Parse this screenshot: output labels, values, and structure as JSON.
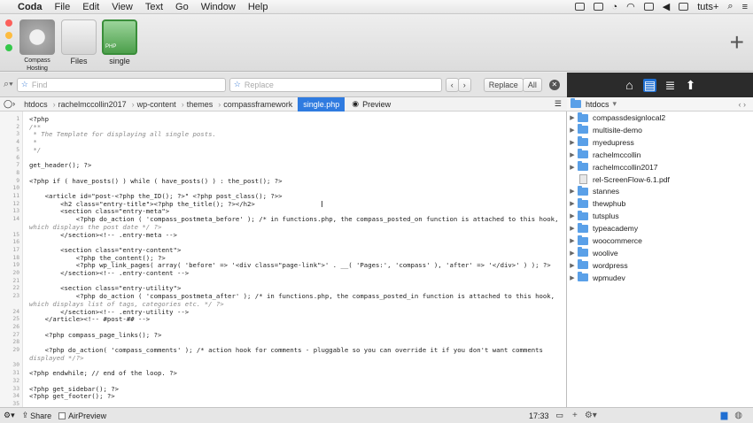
{
  "menubar": {
    "app": "Coda",
    "menus": [
      "File",
      "Edit",
      "View",
      "Text",
      "Go",
      "Window",
      "Help"
    ],
    "user": "tuts+"
  },
  "sites": [
    {
      "label": "Compass Hosting",
      "color": "#a9a9a9"
    },
    {
      "label": "Files",
      "color": "#d7d7d7"
    },
    {
      "label": "single",
      "color": "#7cc47b",
      "badge": "PHP"
    }
  ],
  "find": {
    "find_placeholder": "Find",
    "replace_placeholder": "Replace",
    "replace_btn": "Replace",
    "all_btn": "All"
  },
  "breadcrumbs": [
    "htdocs",
    "rachelmccollin2017",
    "wp-content",
    "themes",
    "compassframework",
    "single.php"
  ],
  "preview_label": "Preview",
  "rightpanel": {
    "path": "htdocs",
    "items": [
      {
        "name": "compassdesignlocal2",
        "type": "folder"
      },
      {
        "name": "multisite-demo",
        "type": "folder"
      },
      {
        "name": "myedupress",
        "type": "folder"
      },
      {
        "name": "rachelmccollin",
        "type": "folder"
      },
      {
        "name": "rachelmccollin2017",
        "type": "folder"
      },
      {
        "name": "rel-ScreenFlow-6.1.pdf",
        "type": "file"
      },
      {
        "name": "stannes",
        "type": "folder"
      },
      {
        "name": "thewphub",
        "type": "folder"
      },
      {
        "name": "tutsplus",
        "type": "folder"
      },
      {
        "name": "typeacademy",
        "type": "folder"
      },
      {
        "name": "woocommerce",
        "type": "folder"
      },
      {
        "name": "woolive",
        "type": "folder"
      },
      {
        "name": "wordpress",
        "type": "folder"
      },
      {
        "name": "wpmudev",
        "type": "folder"
      }
    ]
  },
  "code_lines": [
    "<?php",
    "/**",
    " * The Template for displaying all single posts.",
    " *",
    " */",
    "",
    "get_header(); ?>",
    "",
    "<?php if ( have_posts() ) while ( have_posts() ) : the_post(); ?>",
    "",
    "    <article id=\"post-<?php the_ID(); ?>\" <?php post_class(); ?>>",
    "        <h2 class=\"entry-title\"><?php the_title(); ?></h2>",
    "        <section class=\"entry-meta\">",
    "            <?php do_action ( 'compass_postmeta_before' ); /* in functions.php, the compass_posted_on function is attached to this hook,",
    "which displays the post date */ ?>",
    "        </section><!-- .entry-meta -->",
    "",
    "        <section class=\"entry-content\">",
    "            <?php the_content(); ?>",
    "            <?php wp_link_pages( array( 'before' => '<div class=\"page-link\">' . __( 'Pages:', 'compass' ), 'after' => '</div>' ) ); ?>",
    "        </section><!-- .entry-content -->",
    "",
    "        <section class=\"entry-utility\">",
    "            <?php do_action ( 'compass_postmeta_after' ); /* in functions.php, the compass_posted_in function is attached to this hook,",
    "which displays list of tags, categories etc. */ ?>",
    "        </section><!-- .entry-utility -->",
    "    </article><!-- #post-## -->",
    "",
    "    <?php compass_page_links(); ?>",
    "",
    "    <?php do_action( 'compass_comments' ); /* action hook for comments - pluggable so you can override it if you don't want comments",
    "displayed */?>",
    "",
    "<?php endwhile; // end of the loop. ?>",
    "",
    "<?php get_sidebar(); ?>",
    "<?php get_footer(); ?>",
    ""
  ],
  "line_numbers": [
    "1",
    "2",
    "3",
    "4",
    "5",
    "6",
    "7",
    "8",
    "9",
    "10",
    "11",
    "12",
    "13",
    "14",
    "",
    "15",
    "16",
    "17",
    "18",
    "19",
    "20",
    "21",
    "22",
    "23",
    "",
    "24",
    "25",
    "26",
    "27",
    "28",
    "29",
    "",
    "30",
    "31",
    "32",
    "33",
    "34",
    "35"
  ],
  "status": {
    "share": "Share",
    "airpreview": "AirPreview",
    "cursor": "17:33"
  }
}
